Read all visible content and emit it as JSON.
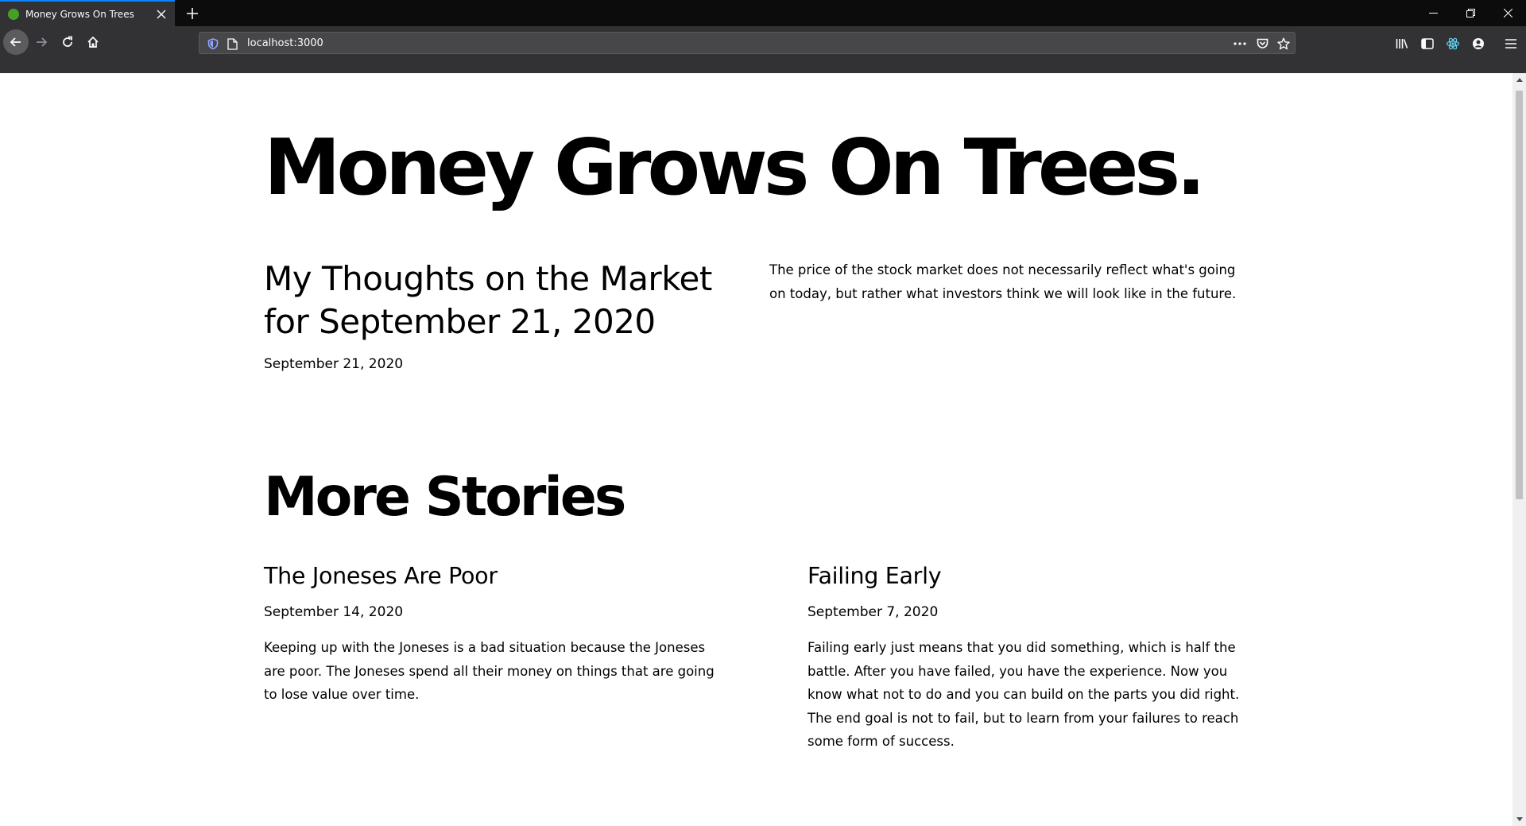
{
  "browser": {
    "tab_title": "Money Grows On Trees",
    "url": "localhost:3000",
    "accent_color": "#0a84ff",
    "favicon_color": "#45a125",
    "icons": [
      "close-icon",
      "plus-icon",
      "minimize-icon",
      "restore-icon",
      "window-close-icon",
      "back-arrow-icon",
      "forward-arrow-icon",
      "reload-icon",
      "home-icon",
      "shield-icon",
      "page-icon",
      "more-actions-icon",
      "pocket-icon",
      "star-icon",
      "library-icon",
      "sidebar-icon",
      "react-devtools-icon",
      "account-icon",
      "menu-icon"
    ]
  },
  "page": {
    "site_title": "Money Grows On Trees.",
    "hero": {
      "title": "My Thoughts on the Market for September 21, 2020",
      "date": "September 21, 2020",
      "excerpt": "The price of the stock market does not necessarily reflect what's going on today, but rather what investors think we will look like in the future."
    },
    "more_stories_heading": "More Stories",
    "stories": [
      {
        "title": "The Joneses Are Poor",
        "date": "September 14, 2020",
        "excerpt": "Keeping up with the Joneses is a bad situation because the Joneses are poor. The Joneses spend all their money on things that are going to lose value over time."
      },
      {
        "title": "Failing Early",
        "date": "September 7, 2020",
        "excerpt": "Failing early just means that you did something, which is half the battle. After you have failed, you have the experience. Now you know what not to do and you can build on the parts you did right. The end goal is not to fail, but to learn from your failures to reach some form of success."
      }
    ]
  }
}
